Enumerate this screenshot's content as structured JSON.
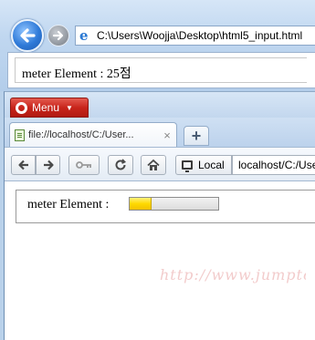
{
  "ie": {
    "address_url": "C:\\Users\\Woojja\\Desktop\\html5_input.html",
    "content_text": "meter Element : 25점"
  },
  "opera": {
    "menu_label": "Menu",
    "tab_title": "file://localhost/C:/User...",
    "tab_close": "×",
    "new_tab": "+",
    "security_label": "Local",
    "address_text": "localhost/C:/Use",
    "content_label": "meter Element :",
    "meter": {
      "value": 25,
      "max": 100,
      "fill_color": "#ffd900"
    }
  },
  "watermark": "http://www.jumptovb.net",
  "colors": {
    "ie_back_blue": "#2f7ad8",
    "opera_red": "#c8261c"
  }
}
